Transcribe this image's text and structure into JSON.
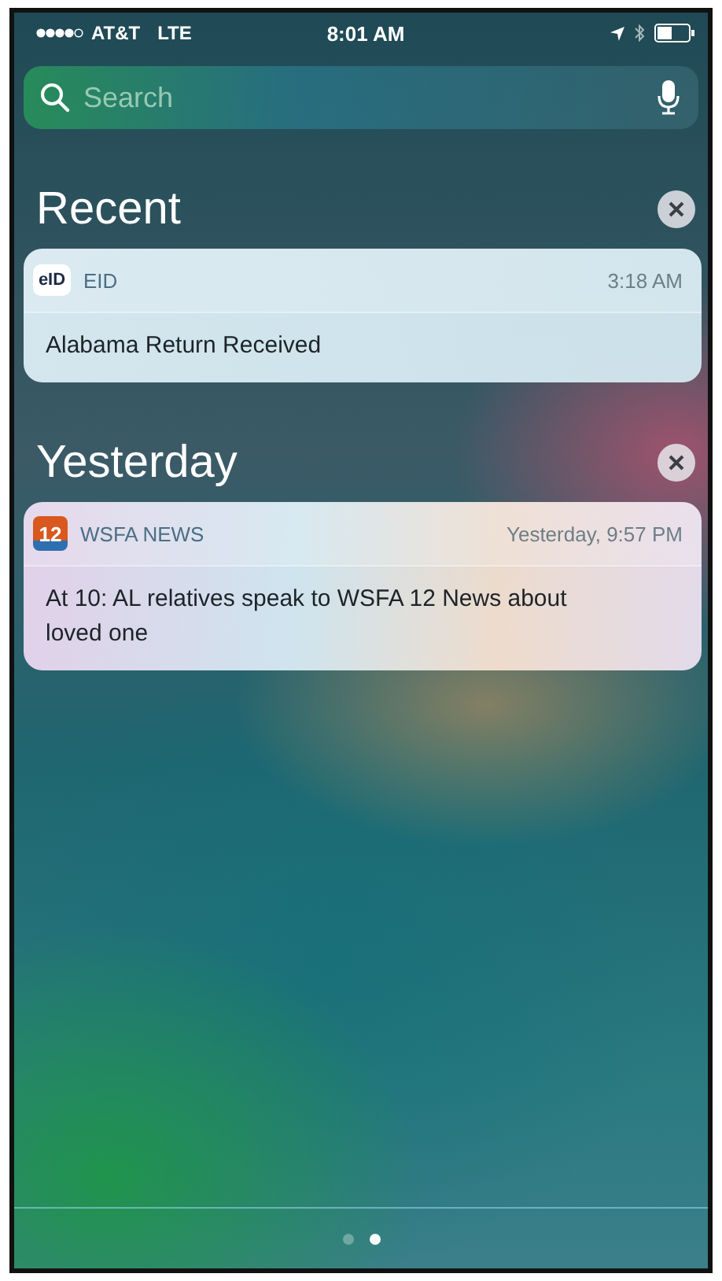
{
  "status_bar": {
    "carrier": "AT&T",
    "network": "LTE",
    "time": "8:01 AM"
  },
  "search": {
    "placeholder": "Search"
  },
  "sections": [
    {
      "title": "Recent",
      "notifications": [
        {
          "app": "EID",
          "app_icon_text": "eID",
          "kind": "eid",
          "time": "3:18 AM",
          "message": "Alabama Return Received"
        }
      ]
    },
    {
      "title": "Yesterday",
      "notifications": [
        {
          "app": "WSFA NEWS",
          "app_icon_text": "12",
          "kind": "news",
          "time": "Yesterday, 9:57 PM",
          "message": "At 10: AL relatives speak to WSFA 12 News about loved one"
        }
      ]
    }
  ],
  "page_dots": [
    {
      "selected": false
    },
    {
      "selected": true
    }
  ]
}
